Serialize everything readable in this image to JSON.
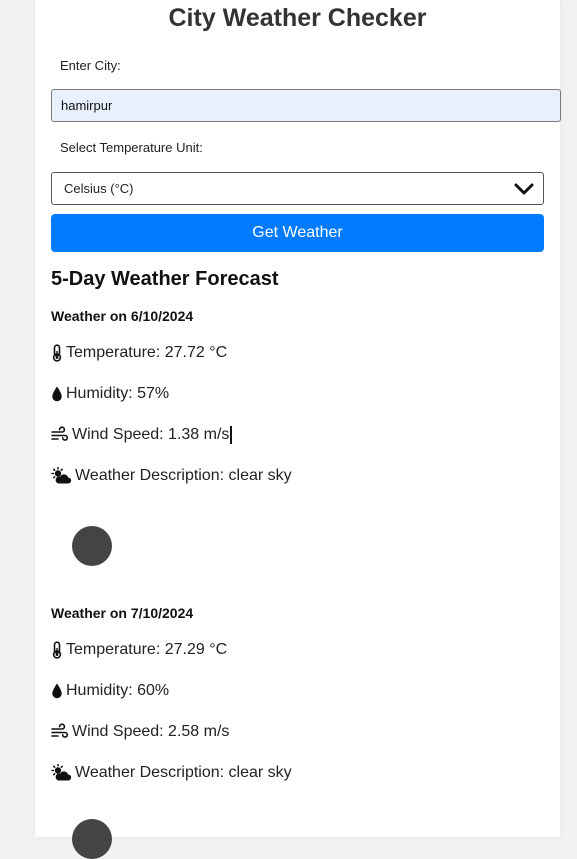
{
  "title": "City Weather Checker",
  "city": {
    "label": "Enter City:",
    "value": "hamirpur"
  },
  "unit": {
    "label": "Select Temperature Unit:",
    "selected": "Celsius (°C)"
  },
  "button": {
    "label": "Get Weather"
  },
  "forecast": {
    "heading": "5-Day Weather Forecast",
    "days": [
      {
        "date": "Weather on 6/10/2024",
        "temperature": "Temperature: 27.72 °C",
        "humidity": "Humidity: 57%",
        "wind": "Wind Speed: 1.38 m/s",
        "description": "Weather Description: clear sky"
      },
      {
        "date": "Weather on 7/10/2024",
        "temperature": "Temperature: 27.29 °C",
        "humidity": "Humidity: 60%",
        "wind": "Wind Speed: 2.58 m/s",
        "description": "Weather Description: clear sky"
      }
    ]
  },
  "icons": {
    "temperature": "thermometer-icon",
    "humidity": "droplet-icon",
    "wind": "wind-icon",
    "description": "cloud-sun-icon",
    "dropdown": "chevron-down-icon"
  },
  "colors": {
    "accent": "#007bff",
    "input_background": "#e8f0fe",
    "page_background": "#f1f2f4"
  }
}
